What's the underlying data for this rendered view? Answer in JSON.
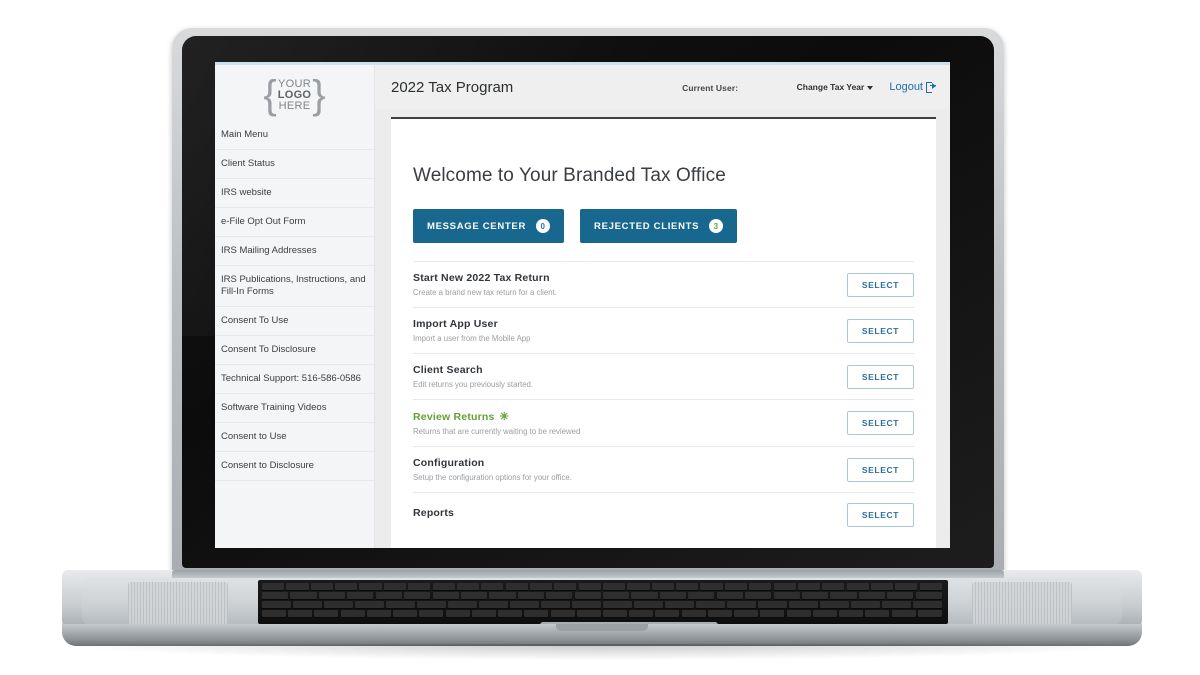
{
  "header": {
    "app_title": "2022 Tax Program",
    "current_user_label": "Current User:",
    "current_user_value": "",
    "change_tax_year": "Change Tax Year",
    "logout": "Logout",
    "logout_icon": "logout-arrow-icon",
    "caret_icon": "chevron-down-icon"
  },
  "sidebar": {
    "logo": {
      "line1": "YOUR",
      "line2": "LOGO",
      "line3": "HERE",
      "brace_left": "{",
      "brace_right": "}"
    },
    "items": [
      {
        "label": "Main Menu"
      },
      {
        "label": "Client Status"
      },
      {
        "label": "IRS website"
      },
      {
        "label": "e-File Opt Out Form"
      },
      {
        "label": "IRS Mailing Addresses"
      },
      {
        "label": "IRS Publications, Instructions, and Fill-In Forms"
      },
      {
        "label": "Consent To Use"
      },
      {
        "label": "Consent To Disclosure"
      },
      {
        "label": "Technical Support: 516-586-0586"
      },
      {
        "label": "Software Training Videos"
      },
      {
        "label": "Consent to Use"
      },
      {
        "label": "Consent to Disclosure"
      }
    ]
  },
  "main": {
    "welcome_title": "Welcome to Your Branded Tax Office",
    "buttons": [
      {
        "label": "MESSAGE CENTER",
        "count": "0",
        "count_color": "#2c6f9c"
      },
      {
        "label": "REJECTED CLIENTS",
        "count": "3",
        "count_color": "#62a233"
      }
    ],
    "select_label": "SELECT",
    "rows": [
      {
        "title": "Start New 2022 Tax Return",
        "sub": "Create a brand new tax return for a client.",
        "highlight": false,
        "star": ""
      },
      {
        "title": "Import App User",
        "sub": "Import a user from the Mobile App",
        "highlight": false,
        "star": ""
      },
      {
        "title": "Client Search",
        "sub": "Edit returns you previously started.",
        "highlight": false,
        "star": ""
      },
      {
        "title": "Review Returns",
        "sub": "Returns that are currently waiting to be reviewed",
        "highlight": true,
        "star": "✳"
      },
      {
        "title": "Configuration",
        "sub": "Setup the configuration options for your office.",
        "highlight": false,
        "star": ""
      },
      {
        "title": "Reports",
        "sub": "",
        "highlight": false,
        "star": ""
      }
    ]
  },
  "theme": {
    "accent_blue": "#18678f",
    "link_blue": "#1f6ea8",
    "accent_green": "#62a233",
    "sidebar_bg": "#f4f5f6",
    "header_bg": "#efefef"
  }
}
